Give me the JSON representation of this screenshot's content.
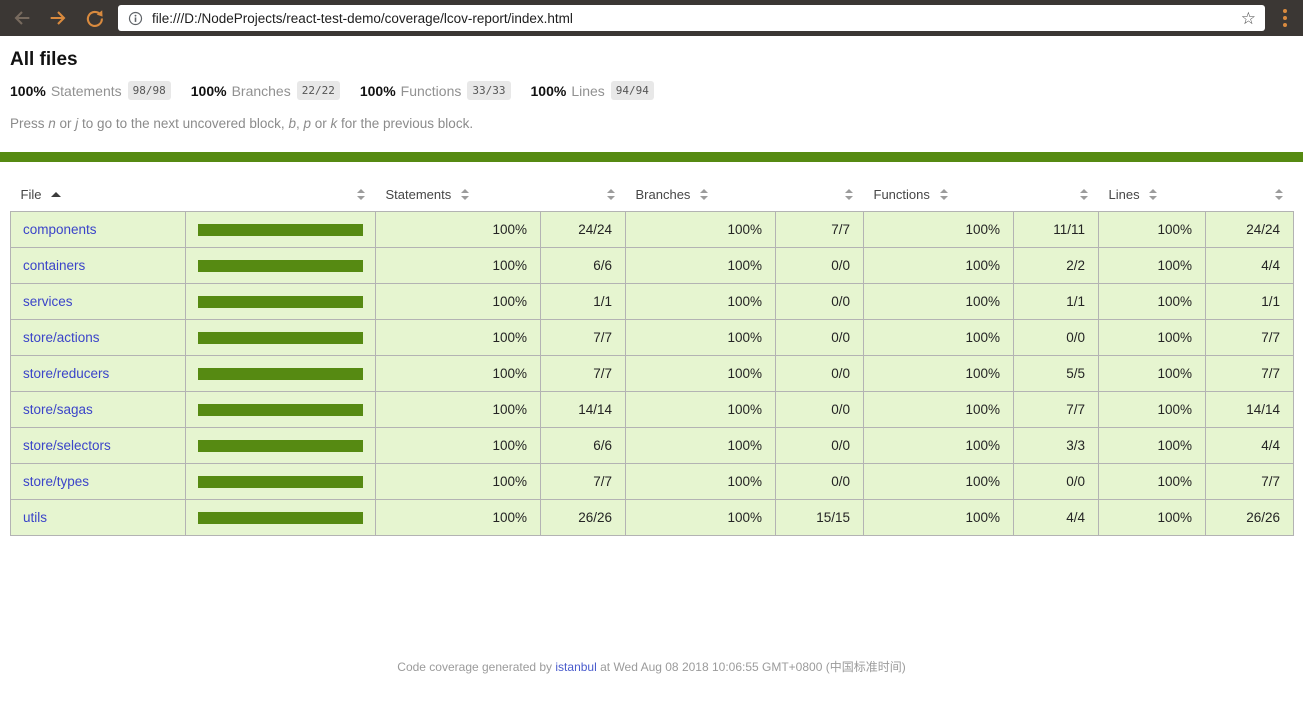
{
  "browser": {
    "url": "file:///D:/NodeProjects/react-test-demo/coverage/lcov-report/index.html",
    "icons": {
      "back": "back-arrow",
      "forward": "forward-arrow",
      "reload": "reload",
      "page_info": "info-circle",
      "bookmark": "star-outline",
      "menu": "three-dots-vertical"
    }
  },
  "colors": {
    "accent_green": "#568a12",
    "row_background": "#e6f5d0",
    "badge_background": "#e8e8e8",
    "toolbar_background": "#3b3734",
    "toolbar_accent_orange": "#d98a3e",
    "link_blue": "#3b44c9"
  },
  "page": {
    "title": "All files",
    "summary": [
      {
        "pct": "100%",
        "label": "Statements",
        "fraction": "98/98"
      },
      {
        "pct": "100%",
        "label": "Branches",
        "fraction": "22/22"
      },
      {
        "pct": "100%",
        "label": "Functions",
        "fraction": "33/33"
      },
      {
        "pct": "100%",
        "label": "Lines",
        "fraction": "94/94"
      }
    ],
    "instruction_parts": [
      {
        "t": "Press "
      },
      {
        "t": "n",
        "i": true
      },
      {
        "t": " or "
      },
      {
        "t": "j",
        "i": true
      },
      {
        "t": " to go to the next uncovered block, "
      },
      {
        "t": "b",
        "i": true
      },
      {
        "t": ", "
      },
      {
        "t": "p",
        "i": true
      },
      {
        "t": " or "
      },
      {
        "t": "k",
        "i": true
      },
      {
        "t": " for the previous block."
      }
    ]
  },
  "table": {
    "header": [
      {
        "label": "File",
        "sort": "asc"
      },
      {
        "label": "",
        "sort": "both"
      },
      {
        "label": "Statements",
        "sort": "both"
      },
      {
        "label": "",
        "sort": "both"
      },
      {
        "label": "Branches",
        "sort": "both"
      },
      {
        "label": "",
        "sort": "both"
      },
      {
        "label": "Functions",
        "sort": "both"
      },
      {
        "label": "",
        "sort": "both"
      },
      {
        "label": "Lines",
        "sort": "both"
      },
      {
        "label": "",
        "sort": "both"
      }
    ],
    "rows": [
      {
        "file": "components",
        "bar_pct": 100,
        "statements_pct": "100%",
        "statements": "24/24",
        "branches_pct": "100%",
        "branches": "7/7",
        "functions_pct": "100%",
        "functions": "11/11",
        "lines_pct": "100%",
        "lines": "24/24"
      },
      {
        "file": "containers",
        "bar_pct": 100,
        "statements_pct": "100%",
        "statements": "6/6",
        "branches_pct": "100%",
        "branches": "0/0",
        "functions_pct": "100%",
        "functions": "2/2",
        "lines_pct": "100%",
        "lines": "4/4"
      },
      {
        "file": "services",
        "bar_pct": 100,
        "statements_pct": "100%",
        "statements": "1/1",
        "branches_pct": "100%",
        "branches": "0/0",
        "functions_pct": "100%",
        "functions": "1/1",
        "lines_pct": "100%",
        "lines": "1/1"
      },
      {
        "file": "store/actions",
        "bar_pct": 100,
        "statements_pct": "100%",
        "statements": "7/7",
        "branches_pct": "100%",
        "branches": "0/0",
        "functions_pct": "100%",
        "functions": "0/0",
        "lines_pct": "100%",
        "lines": "7/7"
      },
      {
        "file": "store/reducers",
        "bar_pct": 100,
        "statements_pct": "100%",
        "statements": "7/7",
        "branches_pct": "100%",
        "branches": "0/0",
        "functions_pct": "100%",
        "functions": "5/5",
        "lines_pct": "100%",
        "lines": "7/7"
      },
      {
        "file": "store/sagas",
        "bar_pct": 100,
        "statements_pct": "100%",
        "statements": "14/14",
        "branches_pct": "100%",
        "branches": "0/0",
        "functions_pct": "100%",
        "functions": "7/7",
        "lines_pct": "100%",
        "lines": "14/14"
      },
      {
        "file": "store/selectors",
        "bar_pct": 100,
        "statements_pct": "100%",
        "statements": "6/6",
        "branches_pct": "100%",
        "branches": "0/0",
        "functions_pct": "100%",
        "functions": "3/3",
        "lines_pct": "100%",
        "lines": "4/4"
      },
      {
        "file": "store/types",
        "bar_pct": 100,
        "statements_pct": "100%",
        "statements": "7/7",
        "branches_pct": "100%",
        "branches": "0/0",
        "functions_pct": "100%",
        "functions": "0/0",
        "lines_pct": "100%",
        "lines": "7/7"
      },
      {
        "file": "utils",
        "bar_pct": 100,
        "statements_pct": "100%",
        "statements": "26/26",
        "branches_pct": "100%",
        "branches": "15/15",
        "functions_pct": "100%",
        "functions": "4/4",
        "lines_pct": "100%",
        "lines": "26/26"
      }
    ]
  },
  "footer": {
    "prefix": "Code coverage generated by ",
    "link": "istanbul",
    "suffix": " at Wed Aug 08 2018 10:06:55 GMT+0800 (中国标准时间)"
  }
}
